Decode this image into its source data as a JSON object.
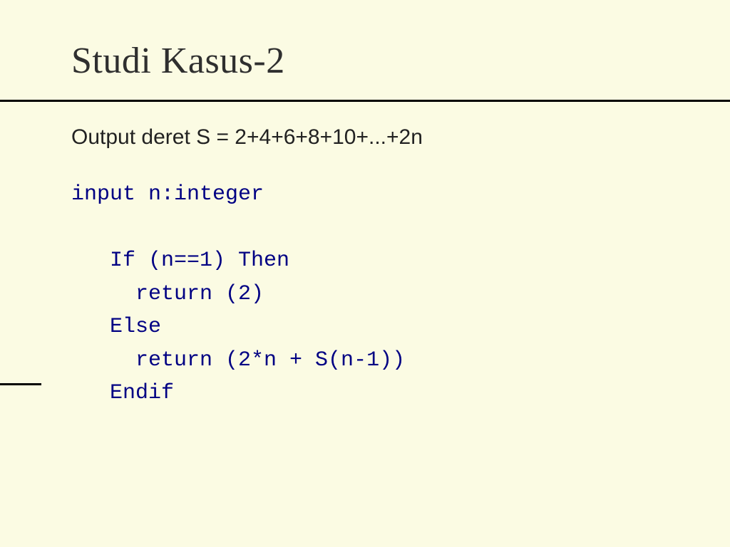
{
  "slide": {
    "title": "Studi Kasus-2",
    "description": "Output deret S = 2+4+6+8+10+...+2n",
    "code_lines": {
      "l0": "input n:integer",
      "l1": "",
      "l2": "   If (n==1) Then",
      "l3": "     return (2)",
      "l4": "   Else",
      "l5": "     return (2*n + S(n-1))",
      "l6": "   Endif"
    }
  }
}
